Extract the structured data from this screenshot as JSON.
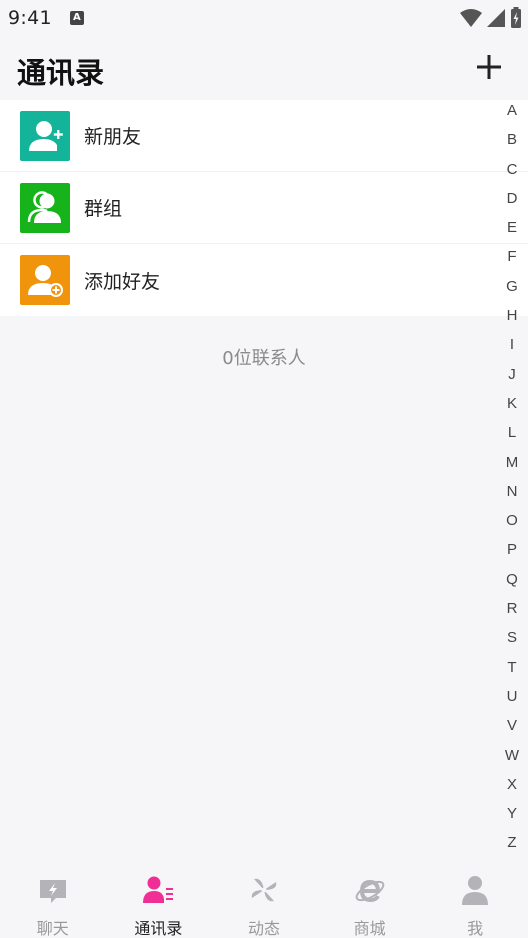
{
  "status_bar": {
    "time": "9:41",
    "app_glyph": "A"
  },
  "header": {
    "title": "通讯录"
  },
  "menu": [
    {
      "label": "新朋友",
      "color": "#13b49a",
      "icon": "person-add-icon"
    },
    {
      "label": "群组",
      "color": "#16b41a",
      "icon": "group-icon"
    },
    {
      "label": "添加好友",
      "color": "#f0940c",
      "icon": "person-plus-circle-icon"
    }
  ],
  "contact_count_text": "0位联系人",
  "alphabet": [
    "A",
    "B",
    "C",
    "D",
    "E",
    "F",
    "G",
    "H",
    "I",
    "J",
    "K",
    "L",
    "M",
    "N",
    "O",
    "P",
    "Q",
    "R",
    "S",
    "T",
    "U",
    "V",
    "W",
    "X",
    "Y",
    "Z"
  ],
  "tabs": [
    {
      "label": "聊天",
      "icon": "chat-bolt-icon",
      "active": false
    },
    {
      "label": "通讯录",
      "icon": "contacts-icon",
      "active": true
    },
    {
      "label": "动态",
      "icon": "pinwheel-icon",
      "active": false
    },
    {
      "label": "商城",
      "icon": "browser-e-icon",
      "active": false
    },
    {
      "label": "我",
      "icon": "profile-icon",
      "active": false
    }
  ],
  "colors": {
    "accent": "#ef2f96",
    "inactive": "#b3b3b8"
  }
}
